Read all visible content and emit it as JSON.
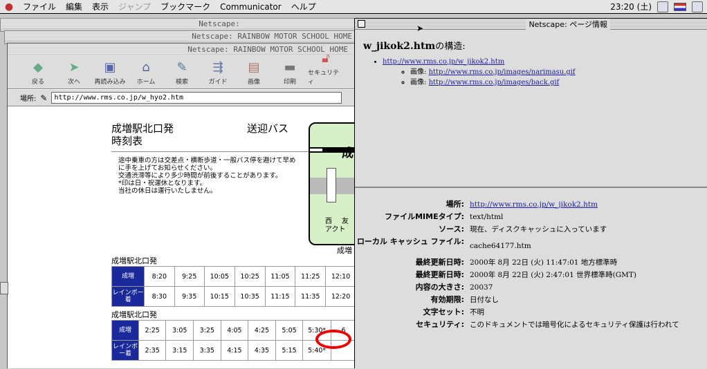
{
  "menubar": {
    "items": [
      "ファイル",
      "編集",
      "表示",
      "ジャンプ",
      "ブックマーク",
      "Communicator",
      "ヘルプ"
    ],
    "clock": "23:20 (土)"
  },
  "windows": {
    "back1_title": "Netscape:",
    "back2_title": "Netscape: RAINBOW MOTOR SCHOOL HOME",
    "main_title": "Netscape: RAINBOW MOTOR SCHOOL HOME"
  },
  "toolbar": {
    "buttons": [
      "戻る",
      "次へ",
      "再読み込み",
      "ホーム",
      "検索",
      "ガイド",
      "画像",
      "印刷",
      "セキュリティ"
    ]
  },
  "location": {
    "label": "場所:",
    "url": "http://www.rms.co.jp/w_hyo2.htm"
  },
  "page": {
    "title_line1": "成増駅北口発",
    "title_line2": "時刻表",
    "title_right": "送迎バス",
    "notice": [
      "途中乗車の方は交差点・横断歩道・一般バス停を避けて早め",
      "に手を上げてお知らせください。",
      "交通渋滞等により多少時間が前後することがあります。",
      "*印は日・祝運休となります。",
      "当社の休日は運行いたしません。"
    ],
    "map_text_top": "成",
    "map_text_left": "西",
    "map_text_right": "友",
    "map_text_bottom": "アクト",
    "map_caption": "成増",
    "section1_label": "成増駅北口発",
    "section2_label": "成増駅北口発",
    "table1": {
      "row1_header": "成増",
      "row1": [
        "8:20",
        "9:25",
        "10:05",
        "10:25",
        "11:05",
        "11:25",
        "12:10"
      ],
      "row2_header": "レインボー着",
      "row2": [
        "8:30",
        "9:35",
        "10:15",
        "10:35",
        "11:15",
        "11:35",
        "12:20"
      ]
    },
    "table2": {
      "row1_header": "成増",
      "row1": [
        "2:25",
        "3:05",
        "3:25",
        "4:05",
        "4:25",
        "5:05",
        "5:30*",
        "6"
      ],
      "row2_header": "レインボー着",
      "row2": [
        "2:35",
        "3:15",
        "3:35",
        "4:15",
        "4:35",
        "5:15",
        "5:40*",
        ""
      ]
    }
  },
  "info_window": {
    "title": "Netscape: ページ情報",
    "header_file": "w_jikok2.htm",
    "header_suffix": "の構造:",
    "main_link": "http://www.rms.co.jp/w_jikok2.htm",
    "images": [
      {
        "label": "画像:",
        "url": "http://www.rms.co.jp/images/narimasu.gif"
      },
      {
        "label": "画像:",
        "url": "http://www.rms.co.jp/images/back.gif"
      }
    ],
    "details": [
      {
        "key": "場所:",
        "value": "http://www.rms.co.jp/w_jikok2.htm",
        "link": true
      },
      {
        "key": "ファイルMIMEタイプ:",
        "value": "text/html"
      },
      {
        "key": "ソース:",
        "value": "現在、ディスクキャッシュに入っています"
      },
      {
        "key": "ローカル キャッシュ ファイル:",
        "value": "cache64177.htm"
      },
      {
        "key": "最終更新日時:",
        "value": "2000年 8月 22日 (火) 11:47:01 地方標準時"
      },
      {
        "key": "最終更新日時:",
        "value": "2000年 8月 22日 (火) 2:47:01 世界標準時(GMT)"
      },
      {
        "key": "内容の大きさ:",
        "value": "20037"
      },
      {
        "key": "有効期限:",
        "value": "日付なし"
      },
      {
        "key": "文字セット:",
        "value": "不明"
      },
      {
        "key": "セキュリティ:",
        "value": "このドキュメントでは暗号化によるセキュリティ保護は行われて"
      }
    ]
  }
}
